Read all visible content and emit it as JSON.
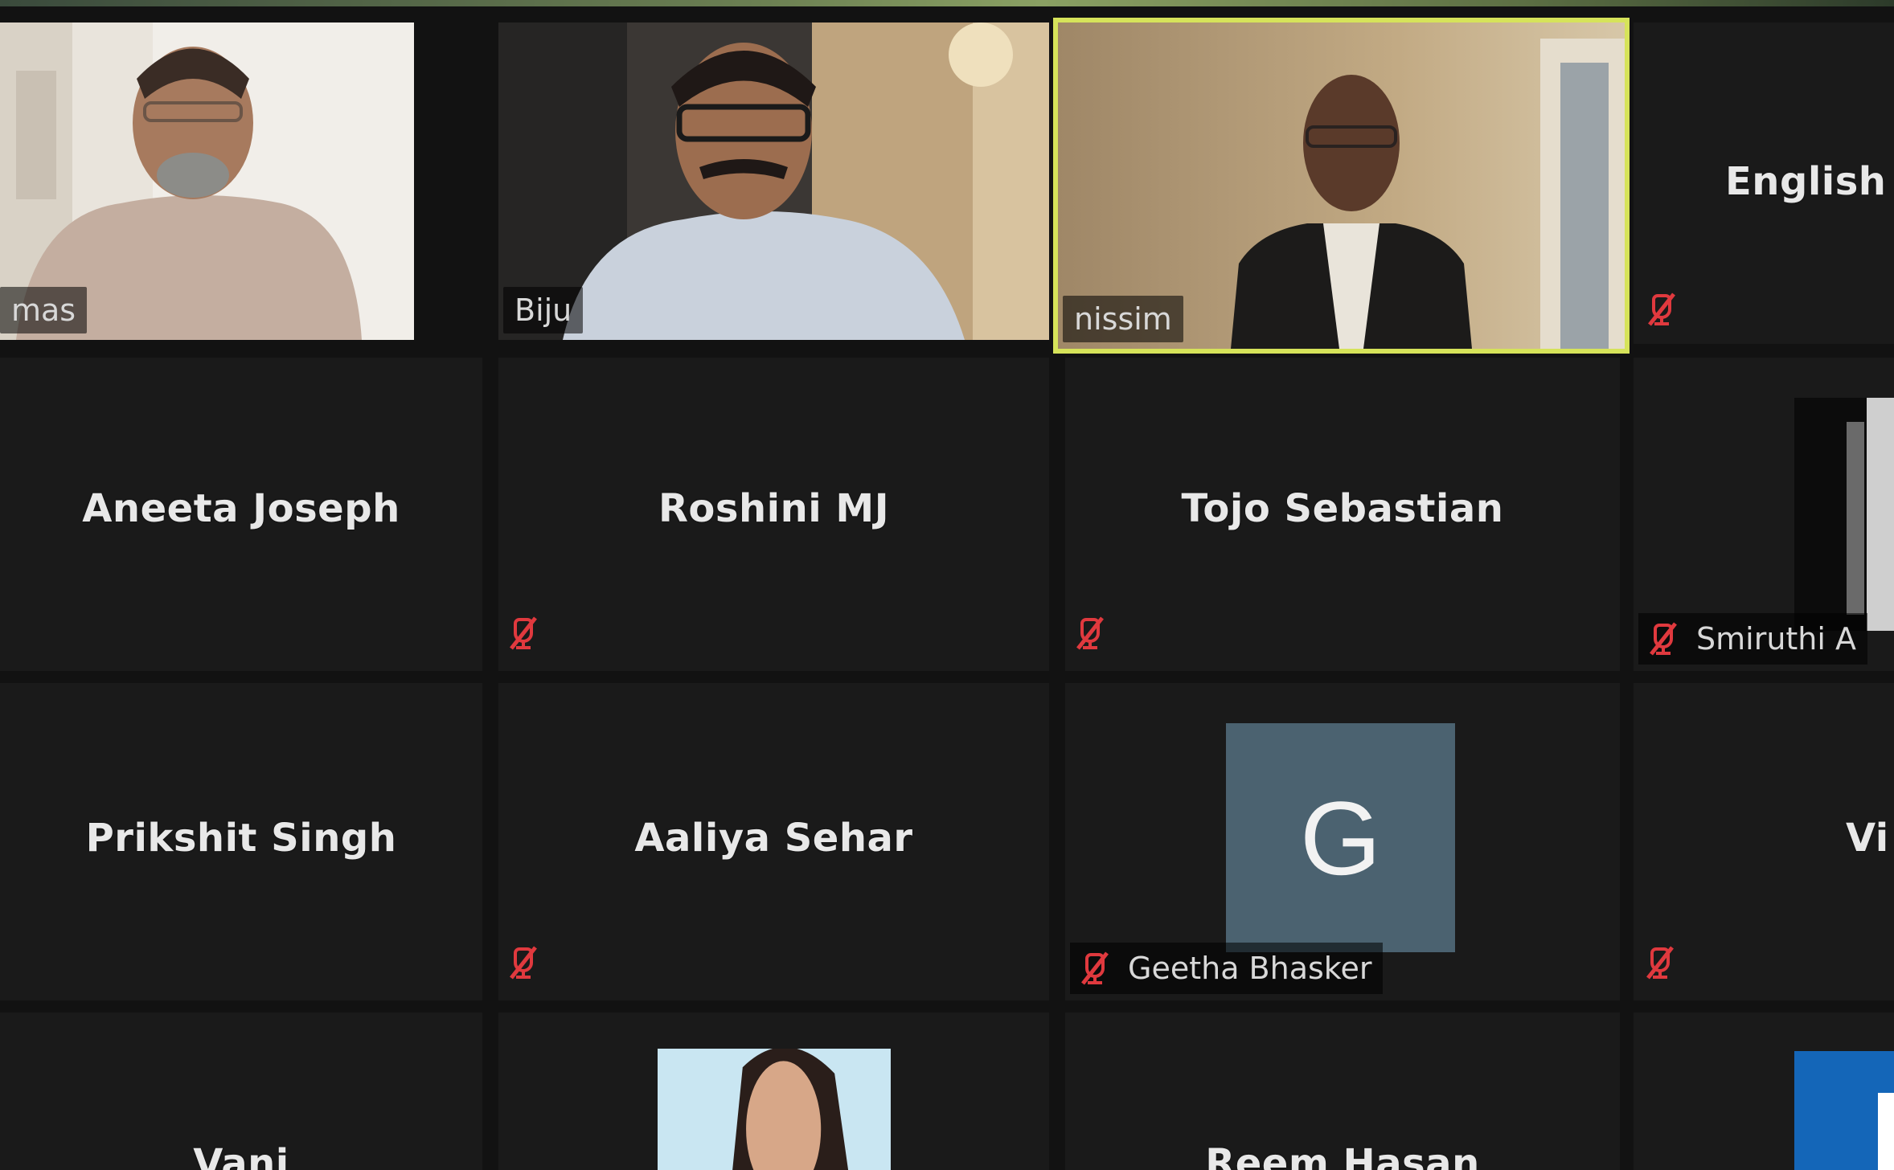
{
  "participants": [
    {
      "name": "mas",
      "video": true
    },
    {
      "name": "Biju",
      "video": true
    },
    {
      "name": "nissim",
      "video": true,
      "active_speaker": true
    },
    {
      "name": "English",
      "video": false,
      "muted": true
    },
    {
      "name": "Aneeta Joseph",
      "video": false
    },
    {
      "name": "Roshini MJ",
      "video": false,
      "muted": true
    },
    {
      "name": "Tojo Sebastian",
      "video": false,
      "muted": true
    },
    {
      "name": "Smiruthi A",
      "video": true,
      "muted": true
    },
    {
      "name": "Prikshit Singh",
      "video": false
    },
    {
      "name": "Aaliya Sehar",
      "video": false,
      "muted": true
    },
    {
      "name": "Geetha Bhasker",
      "video": false,
      "muted": true,
      "avatar_letter": "G"
    },
    {
      "name": "Vi",
      "video": false,
      "muted": true
    },
    {
      "name": "Vani",
      "video": false
    },
    {
      "name": "",
      "video": true
    },
    {
      "name": "Reem Hasan",
      "video": false
    },
    {
      "name": "",
      "video": true
    }
  ],
  "colors": {
    "active_border": "#d6e35a",
    "tile_bg": "#1a1a1a",
    "mute_red": "#e0393e",
    "avatar_bg": "#4b6270"
  },
  "icons": {
    "muted": "mic-muted-icon"
  }
}
